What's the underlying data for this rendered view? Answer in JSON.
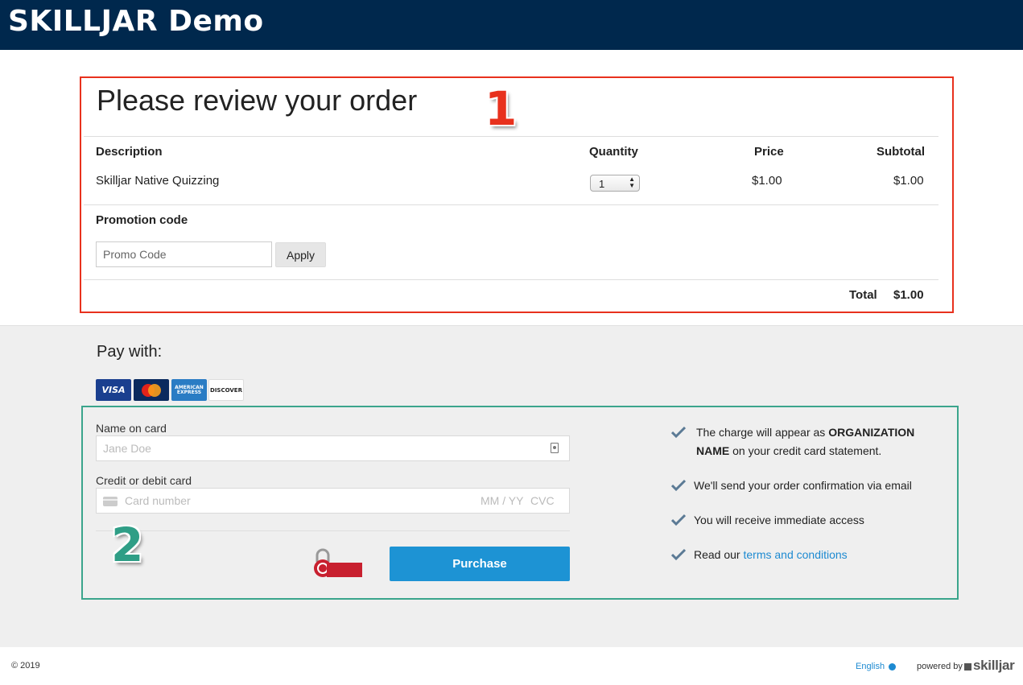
{
  "brand": "SKILLJAR Demo",
  "order": {
    "title": "Please review your order",
    "marker": "1",
    "headers": {
      "description": "Description",
      "quantity": "Quantity",
      "price": "Price",
      "subtotal": "Subtotal"
    },
    "items": [
      {
        "description": "Skilljar Native Quizzing",
        "quantity": "1",
        "price": "$1.00",
        "subtotal": "$1.00"
      }
    ],
    "promo": {
      "label": "Promotion code",
      "placeholder": "Promo Code",
      "apply": "Apply"
    },
    "total_label": "Total",
    "total_value": "$1.00"
  },
  "payment": {
    "title": "Pay with:",
    "cards": [
      "VISA",
      "MasterCard",
      "AMERICAN EXPRESS",
      "DISCOVER"
    ],
    "name_label": "Name on card",
    "name_placeholder": "Jane Doe",
    "card_label": "Credit or debit card",
    "card_placeholder": "Card number",
    "expiry_placeholder": "MM / YY",
    "cvc_placeholder": "CVC",
    "marker": "2",
    "secure_badge": "COMODO SECURE",
    "purchase": "Purchase",
    "info": [
      {
        "pre": "The charge will appear as ",
        "bold": "ORGANIZATION",
        "line2_bold": "NAME",
        "line2": " on your credit card statement."
      },
      {
        "text": "We'll send your order confirmation via email"
      },
      {
        "text": "You will receive immediate access"
      },
      {
        "pre": "Read our ",
        "link": "terms and conditions"
      }
    ]
  },
  "footer": {
    "copyright": "© 2019",
    "language": "English",
    "powered_by": "powered by",
    "skilljar": "skilljar"
  },
  "colors": {
    "header_bg": "#00284d",
    "annotation_red": "#e8311d",
    "annotation_green": "#3ba58c",
    "purchase_button": "#1d93d4",
    "link": "#1d8ad1"
  }
}
